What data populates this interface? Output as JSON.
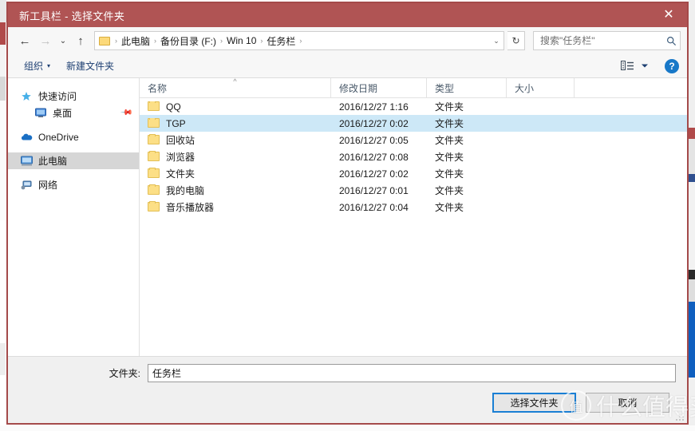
{
  "window": {
    "title": "新工具栏 - 选择文件夹",
    "close_label": "✕",
    "titlebar_color": "#b05454",
    "border_color": "#a44a4a"
  },
  "nav": {
    "back": "←",
    "forward": "→",
    "recent": "⌄",
    "up": "↑",
    "breadcrumbs": [
      {
        "label": "此电脑"
      },
      {
        "label": "备份目录 (F:)"
      },
      {
        "label": "Win 10"
      },
      {
        "label": "任务栏"
      }
    ],
    "separator": "›",
    "address_chevron": "⌄",
    "refresh": "↻"
  },
  "search": {
    "placeholder": "搜索\"任务栏\"",
    "value": "",
    "icon": "search-icon"
  },
  "toolbar": {
    "organize_label": "组织",
    "organize_caret": "▾",
    "new_folder_label": "新建文件夹",
    "help_label": "?"
  },
  "sidebar": {
    "items": [
      {
        "label": "快速访问",
        "icon": "star-icon",
        "selected": false,
        "indent": false,
        "pinned": false
      },
      {
        "label": "桌面",
        "icon": "monitor-icon",
        "selected": false,
        "indent": true,
        "pinned": true
      },
      {
        "label": "OneDrive",
        "icon": "cloud-icon",
        "selected": false,
        "indent": false,
        "pinned": false
      },
      {
        "label": "此电脑",
        "icon": "computer-icon",
        "selected": true,
        "indent": false,
        "pinned": false
      },
      {
        "label": "网络",
        "icon": "network-icon",
        "selected": false,
        "indent": false,
        "pinned": false
      }
    ]
  },
  "filelist": {
    "columns": [
      {
        "label": "名称",
        "sorted": true,
        "sort_caret": "^"
      },
      {
        "label": "修改日期",
        "sorted": false
      },
      {
        "label": "类型",
        "sorted": false
      },
      {
        "label": "大小",
        "sorted": false
      }
    ],
    "rows": [
      {
        "name": "QQ",
        "date": "2016/12/27 1:16",
        "type": "文件夹",
        "size": "",
        "selected": false
      },
      {
        "name": "TGP",
        "date": "2016/12/27 0:02",
        "type": "文件夹",
        "size": "",
        "selected": true
      },
      {
        "name": "回收站",
        "date": "2016/12/27 0:05",
        "type": "文件夹",
        "size": "",
        "selected": false
      },
      {
        "name": "浏览器",
        "date": "2016/12/27 0:08",
        "type": "文件夹",
        "size": "",
        "selected": false
      },
      {
        "name": "文件夹",
        "date": "2016/12/27 0:02",
        "type": "文件夹",
        "size": "",
        "selected": false
      },
      {
        "name": "我的电脑",
        "date": "2016/12/27 0:01",
        "type": "文件夹",
        "size": "",
        "selected": false
      },
      {
        "name": "音乐播放器",
        "date": "2016/12/27 0:04",
        "type": "文件夹",
        "size": "",
        "selected": false
      }
    ]
  },
  "bottom": {
    "folder_label": "文件夹:",
    "folder_value": "任务栏",
    "select_button": "选择文件夹",
    "cancel_button": "取消"
  },
  "watermark": {
    "logo_char": "值",
    "text": "什么值得买"
  }
}
